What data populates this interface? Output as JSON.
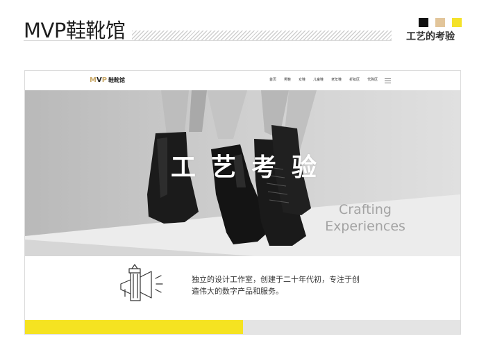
{
  "slide": {
    "title": "MVP鞋靴馆",
    "subtitle": "工艺的考验",
    "swatch_colors": [
      "#111111",
      "#e2c59a",
      "#f4e22a"
    ]
  },
  "nav": {
    "logo_m": "M",
    "logo_v": "V",
    "logo_p": "P",
    "logo_cn": "鞋靴馆",
    "menu": [
      "首页",
      "男鞋",
      "女鞋",
      "儿童鞋",
      "老年鞋",
      "折扣区",
      "代购区"
    ]
  },
  "hero": {
    "title": "工艺考验",
    "subtitle_line1": "Crafting",
    "subtitle_line2": "Experiences"
  },
  "intro": {
    "line1": "独立的设计工作室，创建于二十年代初，专注于创",
    "line2": "造伟大的数字产品和服务。"
  },
  "colors": {
    "accent_yellow": "#f5e321",
    "accent_gold": "#c9a96a",
    "footer_gray": "#e4e4e4"
  }
}
